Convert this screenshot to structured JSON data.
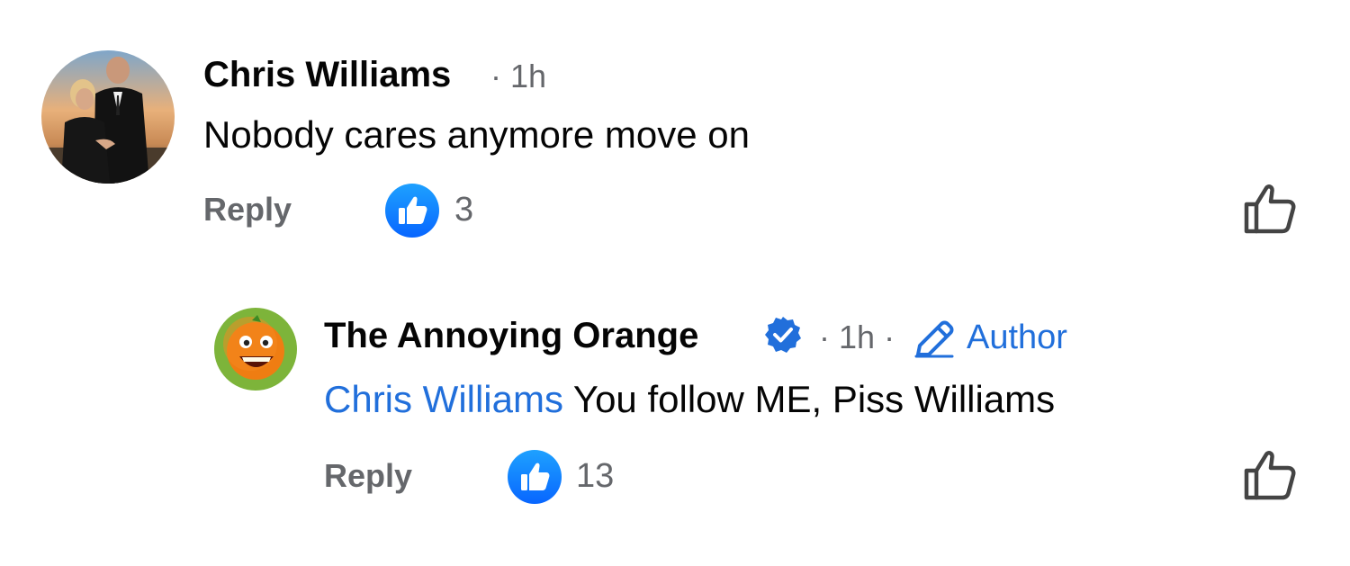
{
  "comments": [
    {
      "author": "Chris Williams",
      "separator": "·",
      "time": "1h",
      "text": "Nobody cares anymore move on",
      "reply_label": "Reply",
      "reaction_count": "3"
    },
    {
      "author": "The Annoying Orange",
      "separator": "·",
      "time": "1h",
      "separator2": "·",
      "author_tag": "Author",
      "mention": "Chris Williams",
      "text": " You follow ME, Piss Williams",
      "reply_label": "Reply",
      "reaction_count": "13"
    }
  ],
  "colors": {
    "link_blue": "#216fdb",
    "meta_gray": "#65676b",
    "reaction_blue": "#0866ff"
  },
  "icons": {
    "verified": "verified-badge-icon",
    "pencil": "pencil-icon",
    "like": "thumbs-up-icon"
  }
}
